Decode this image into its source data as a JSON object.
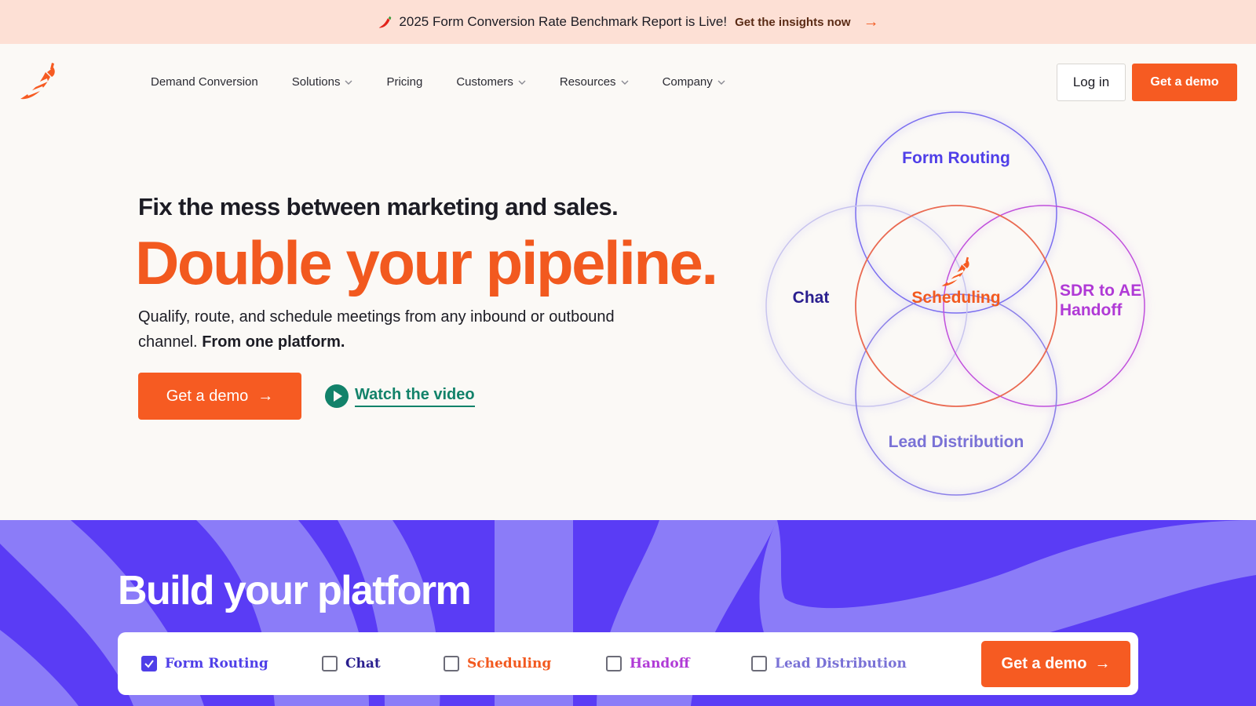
{
  "announcement": {
    "message": "2025 Form Conversion Rate Benchmark Report is Live!",
    "cta": "Get the insights now",
    "arrow": "→",
    "icon": "chili-pepper-icon"
  },
  "nav": {
    "logo_icon": "chili-pepper-logo",
    "items": [
      {
        "label": "Demand Conversion",
        "dropdown": false
      },
      {
        "label": "Solutions",
        "dropdown": true
      },
      {
        "label": "Pricing",
        "dropdown": false
      },
      {
        "label": "Customers",
        "dropdown": true
      },
      {
        "label": "Resources",
        "dropdown": true
      },
      {
        "label": "Company",
        "dropdown": true
      }
    ],
    "login_label": "Log in",
    "demo_label": "Get a demo"
  },
  "hero": {
    "eyebrow": "Fix the mess between marketing and sales.",
    "headline": "Double your pipeline.",
    "sub_text": "Qualify, route, and schedule meetings from any inbound or outbound channel.",
    "sub_bold": "From one platform.",
    "demo_label": "Get a demo",
    "demo_arrow": "→",
    "watch_label": "Watch the video"
  },
  "venn": {
    "top": "Form Routing",
    "left": "Chat",
    "center": "Scheduling",
    "right_line1": "SDR to AE",
    "right_line2": "Handoff",
    "bottom": "Lead Distribution"
  },
  "platform": {
    "title": "Build your platform",
    "options": [
      {
        "label": "Form Routing",
        "checked": true,
        "color": "#4f3fe8"
      },
      {
        "label": "Chat",
        "checked": false,
        "color": "#2a1f8f"
      },
      {
        "label": "Scheduling",
        "checked": false,
        "color": "#f2591f"
      },
      {
        "label": "Handoff",
        "checked": false,
        "color": "#b03ad6"
      },
      {
        "label": "Lead Distribution",
        "checked": false,
        "color": "#7a72d6"
      }
    ],
    "demo_label": "Get a demo",
    "demo_arrow": "→"
  },
  "colors": {
    "accent_orange": "#f65b22",
    "accent_purple": "#5a3cf5",
    "accent_green": "#12826a",
    "announce_bg": "#fde0d5"
  }
}
